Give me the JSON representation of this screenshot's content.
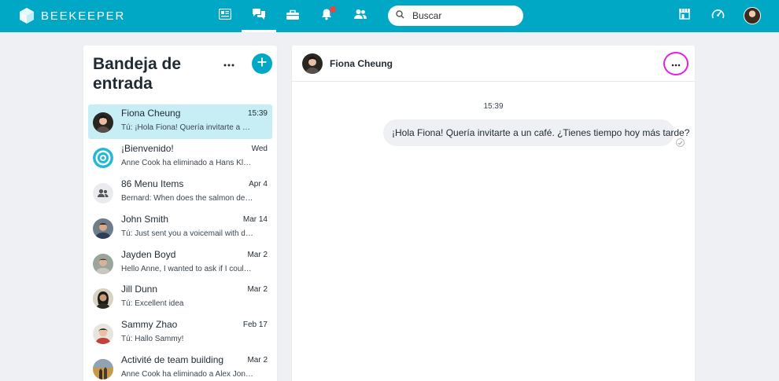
{
  "app": {
    "brand": "BEEKEEPER"
  },
  "topbar": {
    "nav": [
      {
        "icon": "news-feed-icon",
        "active": false
      },
      {
        "icon": "chat-icon",
        "active": true
      },
      {
        "icon": "tools-icon",
        "active": false
      },
      {
        "icon": "bell-icon",
        "active": false,
        "has_notification": true
      },
      {
        "icon": "people-icon",
        "active": false
      }
    ],
    "search": {
      "placeholder": "Buscar"
    },
    "right_icons": [
      "shop-icon",
      "dashboard-gauge-icon",
      "user-avatar"
    ]
  },
  "inbox": {
    "title_line1": "Bandeja de",
    "title_line2": "entrada",
    "conversations": [
      {
        "name": "Fiona Cheung",
        "time": "15:39",
        "preview": "Tú: ¡Hola Fiona! Quería invitarte a un café. ¿Tienes tiempo hoy más tarde?",
        "active": true
      },
      {
        "name": "¡Bienvenido!",
        "time": "Wed",
        "preview": "Anne Cook ha eliminado a Hans Klaus",
        "active": false
      },
      {
        "name": "86 Menu Items",
        "time": "Apr 4",
        "preview": "Bernard: When does the salmon delivery arrive?",
        "active": false
      },
      {
        "name": "John Smith",
        "time": "Mar 14",
        "preview": "Tú: Just sent you a voicemail with details",
        "active": false
      },
      {
        "name": "Jayden Boyd",
        "time": "Mar 2",
        "preview": "Hello Anne, I wanted to ask if I could swap",
        "active": false
      },
      {
        "name": "Jill Dunn",
        "time": "Mar 2",
        "preview": "Tú: Excellent idea",
        "active": false
      },
      {
        "name": "Sammy Zhao",
        "time": "Feb 17",
        "preview": "Tú: Hallo Sammy!",
        "active": false
      },
      {
        "name": "Activité de team building",
        "time": "Mar 2",
        "preview": "Anne Cook ha eliminado a Alex Jones",
        "active": false
      }
    ]
  },
  "chat": {
    "contact_name": "Fiona Cheung",
    "messages": [
      {
        "time": "15:39",
        "text": "¡Hola Fiona! Quería invitarte a un café. ¿Tienes tiempo hoy más tarde?"
      }
    ]
  },
  "colors": {
    "brand": "#00a8c6",
    "active_row": "#c8eef5",
    "highlight_ring": "#e61ee6"
  }
}
